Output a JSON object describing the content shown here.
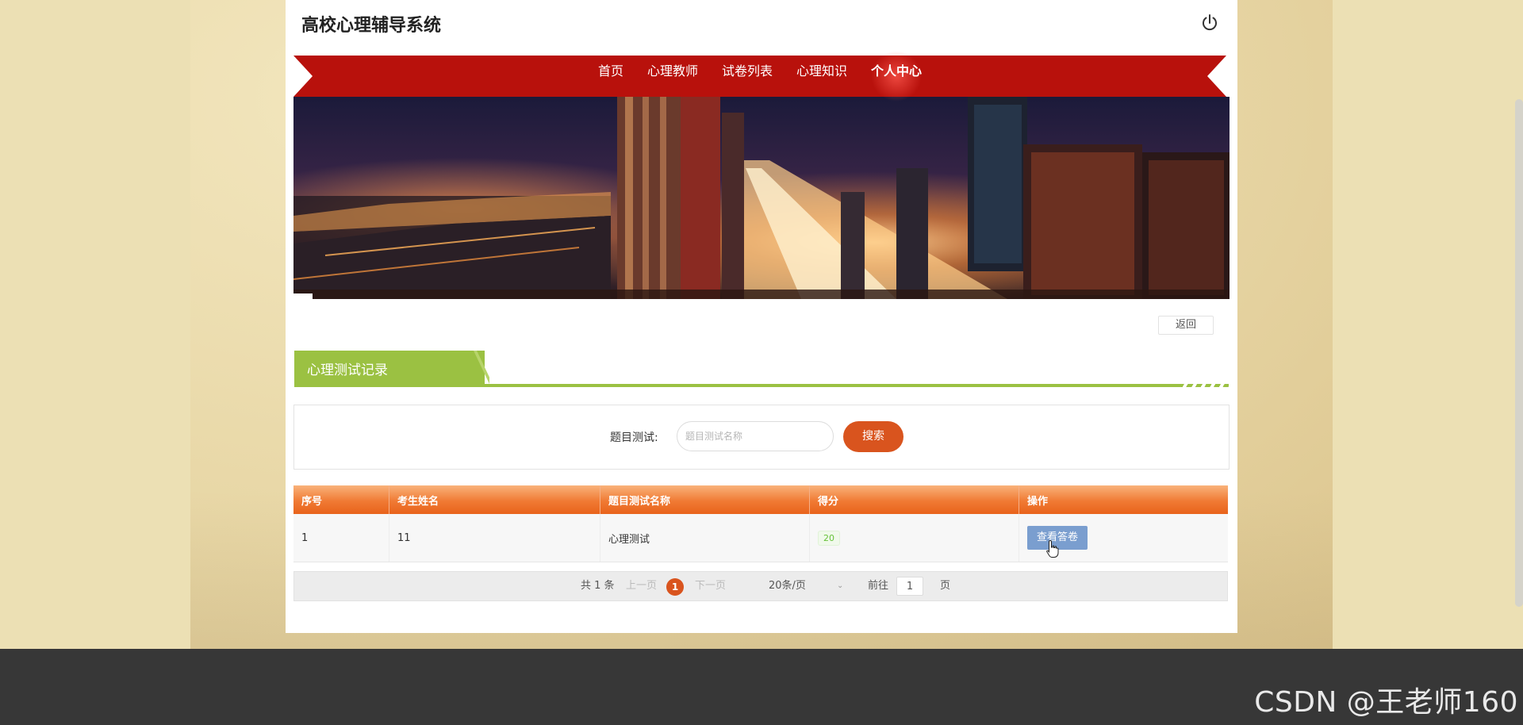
{
  "header": {
    "site_title": "高校心理辅导系统",
    "power_icon": "power-icon"
  },
  "nav": {
    "items": [
      {
        "label": "首页"
      },
      {
        "label": "心理教师"
      },
      {
        "label": "试卷列表"
      },
      {
        "label": "心理知识"
      },
      {
        "label": "个人中心",
        "active": true
      }
    ]
  },
  "banner": {
    "image": "night-city-skyline"
  },
  "back_button": "返回",
  "section": {
    "title": "心理测试记录"
  },
  "search": {
    "label": "题目测试:",
    "placeholder": "题目测试名称",
    "button": "搜索"
  },
  "table": {
    "headers": [
      "序号",
      "考生姓名",
      "题目测试名称",
      "得分",
      "操作"
    ],
    "rows": [
      {
        "index": "1",
        "name": "11",
        "test_name": "心理测试",
        "score": "20",
        "action": "查看答卷"
      }
    ]
  },
  "pagination": {
    "total": "共 1 条",
    "prev": "上一页",
    "current_page": "1",
    "next": "下一页",
    "page_size": "20条/页",
    "goto_label": "前往",
    "goto_value": "1",
    "goto_unit": "页"
  },
  "watermark": "CSDN @王老师160",
  "colors": {
    "nav_red": "#b8110c",
    "section_green": "#9bc142",
    "button_orange": "#d9541e",
    "table_head_orange": "#f07a34",
    "view_button_blue": "#7a9ecf"
  }
}
